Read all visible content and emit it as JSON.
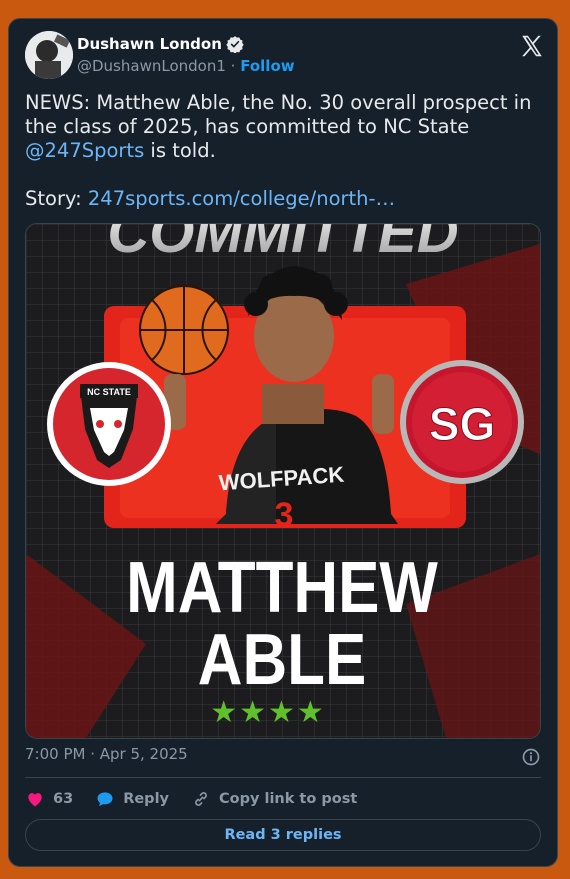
{
  "author": {
    "name": "Dushawn London",
    "handle": "@DushawnLondon1",
    "separator": "·",
    "follow_label": "Follow",
    "verified": true
  },
  "platform_icon": "x-logo-icon",
  "tweet": {
    "line1": "NEWS: Matthew Able, the No. 30 overall prospect in the class of 2025, has committed to NC State",
    "mention": "@247Sports",
    "line1_end": " is told.",
    "story_label": "Story: ",
    "story_link": "247sports.com/college/north-…"
  },
  "media": {
    "banner_text": "COMMITTED",
    "school_logo_text": "NC STATE",
    "position_badge": "SG",
    "jersey_text": "WOLFPACK",
    "jersey_number": "3",
    "player_first": "MATTHEW",
    "player_last": "ABLE",
    "stars": "★★★★",
    "colors": {
      "red": "#e3241b",
      "dark": "#1c1c1e",
      "star_green": "#5fc02b"
    }
  },
  "timestamp": "7:00 PM · Apr 5, 2025",
  "actions": {
    "likes_count": "63",
    "reply_label": "Reply",
    "copy_label": "Copy link to post"
  },
  "read_replies_label": "Read 3 replies",
  "colors": {
    "accent": "#1d9bf0",
    "background": "#15202b",
    "page": "#c9590f",
    "like": "#f91880"
  }
}
